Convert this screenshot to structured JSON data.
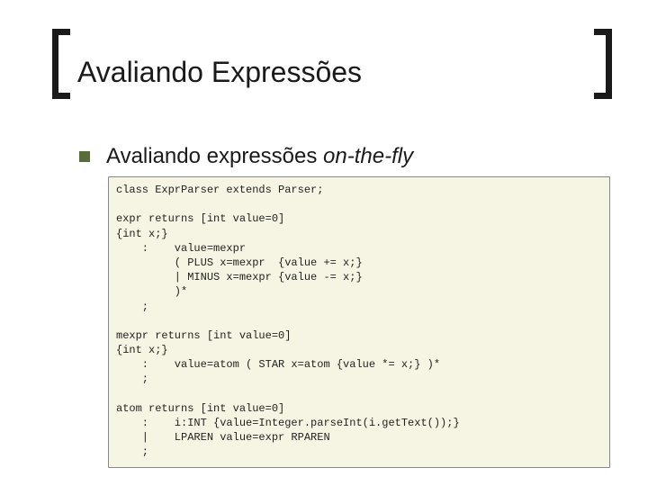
{
  "title": "Avaliando Expressões",
  "subtitle": {
    "prefix": "Avaliando expressões ",
    "italic": "on-the-fly"
  },
  "code": "class ExprParser extends Parser;\n\nexpr returns [int value=0]\n{int x;}\n    :    value=mexpr\n         ( PLUS x=mexpr  {value += x;}\n         | MINUS x=mexpr {value -= x;}\n         )*\n    ;\n\nmexpr returns [int value=0]\n{int x;}\n    :    value=atom ( STAR x=atom {value *= x;} )*\n    ;\n\natom returns [int value=0]\n    :    i:INT {value=Integer.parseInt(i.getText());}\n    |    LPAREN value=expr RPAREN\n    ;"
}
